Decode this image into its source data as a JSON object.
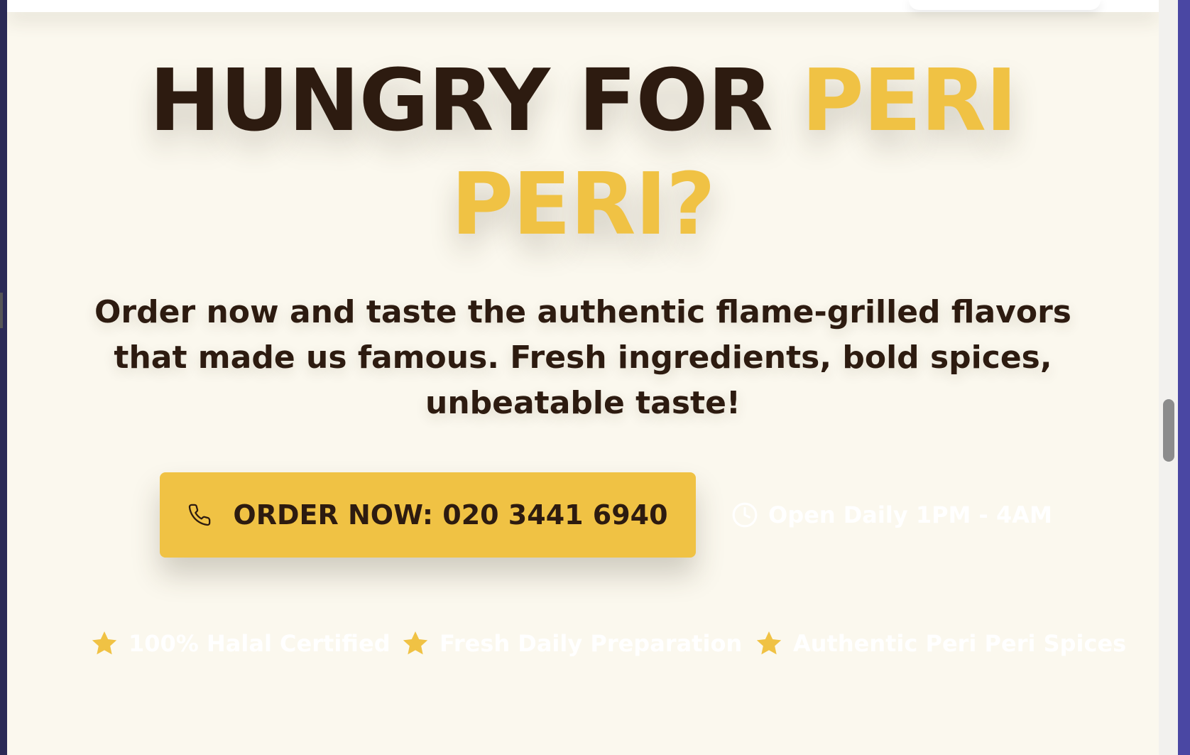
{
  "hero": {
    "headline_part1": "HUNGRY FOR ",
    "headline_part2": "PERI PERI?",
    "subtitle": "Order now and taste the authentic flame-grilled flavors that made us famous. Fresh ingredients, bold spices, unbeatable taste!"
  },
  "cta": {
    "order_label": "ORDER NOW: 020 3441 6940",
    "order_icon": "phone-icon",
    "hours_label": "Open Daily 1PM - 4AM",
    "hours_icon": "clock-icon"
  },
  "features": [
    {
      "label": "100% Halal Certified",
      "icon": "star-icon"
    },
    {
      "label": "Fresh Daily Preparation",
      "icon": "star-icon"
    },
    {
      "label": "Authentic Peri Peri Spices",
      "icon": "star-icon"
    }
  ],
  "colors": {
    "background": "#fbf8ee",
    "text_dark": "#2d1b10",
    "accent_yellow": "#f0c244",
    "white": "#ffffff"
  }
}
